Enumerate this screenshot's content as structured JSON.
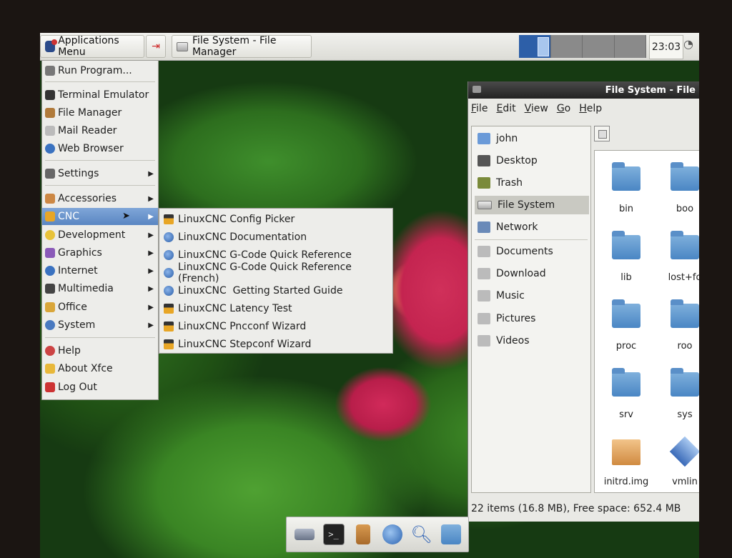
{
  "panel": {
    "apps_button": "Applications Menu",
    "task": "File System - File Manager",
    "clock": "23:03"
  },
  "apps_menu": {
    "items": [
      {
        "label": "Run Program..."
      },
      {
        "label": "Terminal Emulator"
      },
      {
        "label": "File Manager"
      },
      {
        "label": "Mail Reader"
      },
      {
        "label": "Web Browser"
      },
      {
        "label": "Settings"
      },
      {
        "label": "Accessories"
      },
      {
        "label": "CNC"
      },
      {
        "label": "Development"
      },
      {
        "label": "Graphics"
      },
      {
        "label": "Internet"
      },
      {
        "label": "Multimedia"
      },
      {
        "label": "Office"
      },
      {
        "label": "System"
      },
      {
        "label": "Help"
      },
      {
        "label": "About Xfce"
      },
      {
        "label": "Log Out"
      }
    ]
  },
  "cnc_menu": {
    "items": [
      {
        "label": "LinuxCNC Config Picker"
      },
      {
        "label": "LinuxCNC Documentation"
      },
      {
        "label": "LinuxCNC G-Code Quick Reference"
      },
      {
        "label": "LinuxCNC G-Code Quick Reference (French)"
      },
      {
        "label": "LinuxCNC  Getting Started Guide"
      },
      {
        "label": "LinuxCNC Latency Test"
      },
      {
        "label": "LinuxCNC Pncconf Wizard"
      },
      {
        "label": "LinuxCNC Stepconf Wizard"
      }
    ]
  },
  "file_manager": {
    "title": "File System - File",
    "menubar": [
      "File",
      "Edit",
      "View",
      "Go",
      "Help"
    ],
    "places": [
      {
        "label": "john"
      },
      {
        "label": "Desktop"
      },
      {
        "label": "Trash"
      },
      {
        "label": "File System"
      },
      {
        "label": "Network"
      },
      {
        "label": "Documents"
      },
      {
        "label": "Download"
      },
      {
        "label": "Music"
      },
      {
        "label": "Pictures"
      },
      {
        "label": "Videos"
      }
    ],
    "files": [
      {
        "label": "bin"
      },
      {
        "label": "boo"
      },
      {
        "label": "lib"
      },
      {
        "label": "lost+fo"
      },
      {
        "label": "proc"
      },
      {
        "label": "roo"
      },
      {
        "label": "srv"
      },
      {
        "label": "sys"
      },
      {
        "label": "initrd.img"
      },
      {
        "label": "vmlin"
      }
    ],
    "status": "22 items (16.8 MB), Free space: 652.4 MB"
  },
  "colors": {
    "menu_highlight": "#6a93cc",
    "folder": "#5a92cc",
    "panel_bg": "#e6e6e0"
  }
}
